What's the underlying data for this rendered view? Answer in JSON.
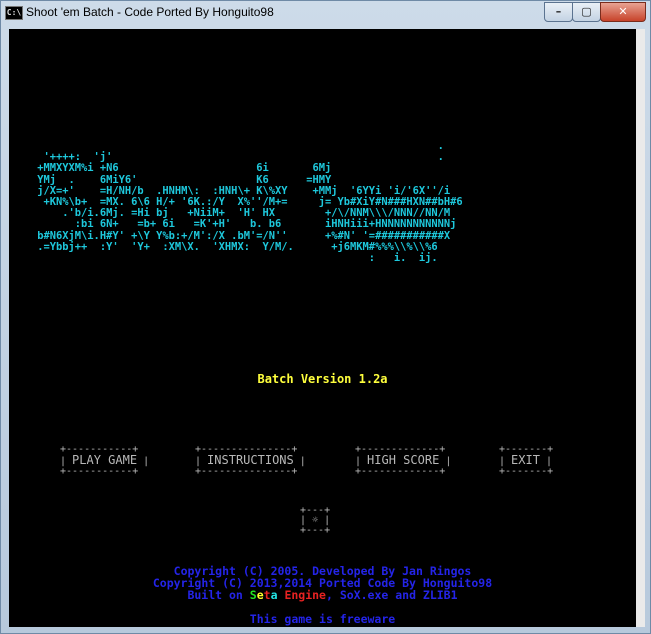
{
  "window": {
    "title": "Shoot 'em Batch - Code Ported By Honguito98",
    "icon_text": "C:\\",
    "buttons": {
      "minimize": "–",
      "maximize": "▢",
      "close": "✕"
    }
  },
  "logo_lines": [
    "                                                                 .",
    "  '++++:  'j'                                                    .",
    " +MMXYXM%i +N6                      6i       6Mj",
    " YMj  .    6MiY6'                   K6      =HMY",
    " j/X=+'    =H/NH/b  .HNHM\\:  :HNH\\+ K\\%XY    +MMj  '6YYi 'i/'6X''/i",
    "  +KN%\\b+  =MX. 6\\6 H/+ '6K.:/Y  X%''/M+=     j= Yb#XiY#N###HXN##bH#6",
    "     .'b/i.6Mj. =Hi bj   +NiiM+  'H' HX        +/\\/NNM\\\\\\/NNN//NN/M",
    "       :bi 6N+   =b+ 6i   =K'+H'   b. b6       iHNHiii+HNNNNNNNNNNNj",
    " b#N6XjM\\i.H#Y' +\\Y Y%b:+/M':/X .bM'=/N''      +%#N' '=###########X",
    " .=Ybbj++  :Y'  'Y+  :XM\\X.  'XHMX:  Y/M/.      +j6MKM#%%%\\\\%\\\\%6",
    "                                                      :   i.  ij."
  ],
  "version": "Batch Version 1.2a",
  "menu": [
    {
      "label": "PLAY GAME"
    },
    {
      "label": "INSTRUCTIONS"
    },
    {
      "label": "HIGH SCORE"
    },
    {
      "label": "EXIT"
    }
  ],
  "settings_icon": "☼",
  "credits": {
    "line1": "Copyright (C) 2005. Developed By Jan Ringos",
    "line2": "Copyright (C) 2013,2014 Ported Code By Honguito98",
    "line3_prefix": "Built on ",
    "seta": [
      "S",
      "e",
      "t",
      "a"
    ],
    "engine": "Engine",
    "line3_suffix": ", SoX.exe and ZLIB1",
    "freeware": "This game is freeware"
  },
  "colors": {
    "logo": "#1ec8dc",
    "version": "#ffff3c",
    "menu": "#b8b8b8",
    "credits": "#2424e8"
  }
}
